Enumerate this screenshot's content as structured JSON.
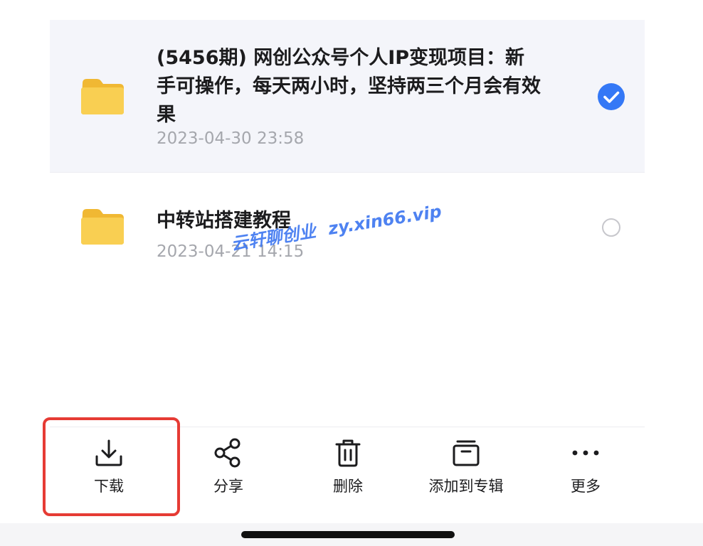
{
  "files": [
    {
      "title": "(5456期) 网创公众号个人IP变现项目：新手可操作，每天两小时，坚持两三个月会有效果",
      "date": "2023-04-30 23:58",
      "selected": true,
      "icon": "folder-icon"
    },
    {
      "title": "中转站搭建教程",
      "date": "2023-04-21 14:15",
      "selected": false,
      "icon": "folder-icon"
    }
  ],
  "watermark": {
    "brand": "云轩聊创业",
    "url": "zy.xin66.vip"
  },
  "toolbar": {
    "download": {
      "label": "下载",
      "icon": "download-icon"
    },
    "share": {
      "label": "分享",
      "icon": "share-icon"
    },
    "delete": {
      "label": "删除",
      "icon": "trash-icon"
    },
    "add_to_album": {
      "label": "添加到专辑",
      "icon": "album-icon"
    },
    "more": {
      "label": "更多",
      "icon": "more-icon"
    }
  },
  "colors": {
    "accent": "#3478f6",
    "folder": "#f7c844",
    "highlight": "#e63b34",
    "watermark": "#3f78f0"
  }
}
